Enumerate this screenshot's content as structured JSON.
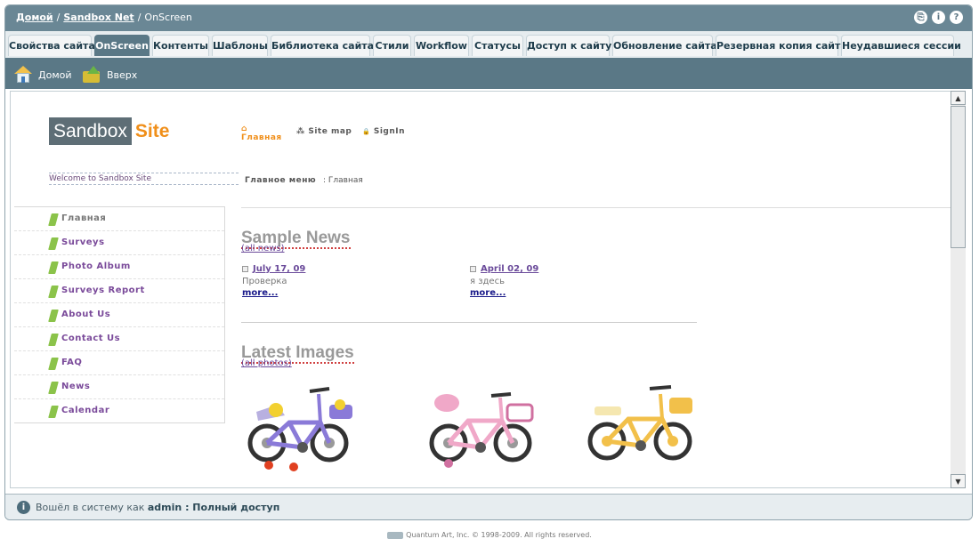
{
  "breadcrumb": {
    "home": "Домой",
    "site": "Sandbox Net",
    "current": "OnScreen",
    "separator": "/"
  },
  "title_icons": [
    "save-icon",
    "info-icon",
    "help-icon"
  ],
  "title_icon_glyphs": {
    "save": "⎘",
    "info": "i",
    "help": "?"
  },
  "tabs": [
    {
      "label": "Свойства сайта",
      "active": false
    },
    {
      "label": "OnScreen",
      "active": true
    },
    {
      "label": "Контенты",
      "active": false
    },
    {
      "label": "Шаблоны",
      "active": false
    },
    {
      "label": "Библиотека сайта",
      "active": false
    },
    {
      "label": "Стили",
      "active": false
    },
    {
      "label": "Workflow",
      "active": false
    },
    {
      "label": "Статусы",
      "active": false
    },
    {
      "label": "Доступ к сайту",
      "active": false
    },
    {
      "label": "Обновление сайта",
      "active": false
    },
    {
      "label": "Резервная копия сайта",
      "active": false
    },
    {
      "label": "Неудавшиеся сессии",
      "active": false
    }
  ],
  "toolbar": {
    "home": "Домой",
    "up": "Вверх"
  },
  "site": {
    "logo_part1": "Sandbox",
    "logo_part2": "Site",
    "nav_home": "Главная",
    "nav_home_icon": "⌂",
    "nav_sitemap": "Site map",
    "nav_sitemap_icon": "⁂",
    "nav_signin": "SignIn",
    "nav_signin_icon": "🔒",
    "welcome": "Welcome to Sandbox Site",
    "main_menu": "Главное меню",
    "crumb_here": ": Главная"
  },
  "sidebar": [
    {
      "label": "Главная"
    },
    {
      "label": "Surveys"
    },
    {
      "label": "Photo Album"
    },
    {
      "label": "Surveys Report"
    },
    {
      "label": "About Us"
    },
    {
      "label": "Contact Us"
    },
    {
      "label": "FAQ"
    },
    {
      "label": "News"
    },
    {
      "label": "Calendar"
    }
  ],
  "news_section": {
    "title": "Sample News",
    "all_link": "(all news)",
    "items": [
      {
        "date": "July 17, 09",
        "text": "Проверка",
        "more": "more..."
      },
      {
        "date": "April 02, 09",
        "text": "я здесь",
        "more": "more..."
      }
    ]
  },
  "images_section": {
    "title": "Latest Images",
    "all_link": "(all photos)",
    "images": [
      {
        "alt": "purple-bicycle",
        "color": "#8a7ad8"
      },
      {
        "alt": "pink-bicycle",
        "color": "#f0a8c8"
      },
      {
        "alt": "yellow-bicycle",
        "color": "#f2c04a"
      }
    ]
  },
  "status": {
    "prefix": "Вошёл в систему как",
    "user": "admin : Полный доступ",
    "icon": "i"
  },
  "footer": {
    "text": "Quantum Art, Inc. © 1998-2009. All rights reserved."
  },
  "scrollbar": {
    "up": "▲",
    "down": "▼"
  }
}
